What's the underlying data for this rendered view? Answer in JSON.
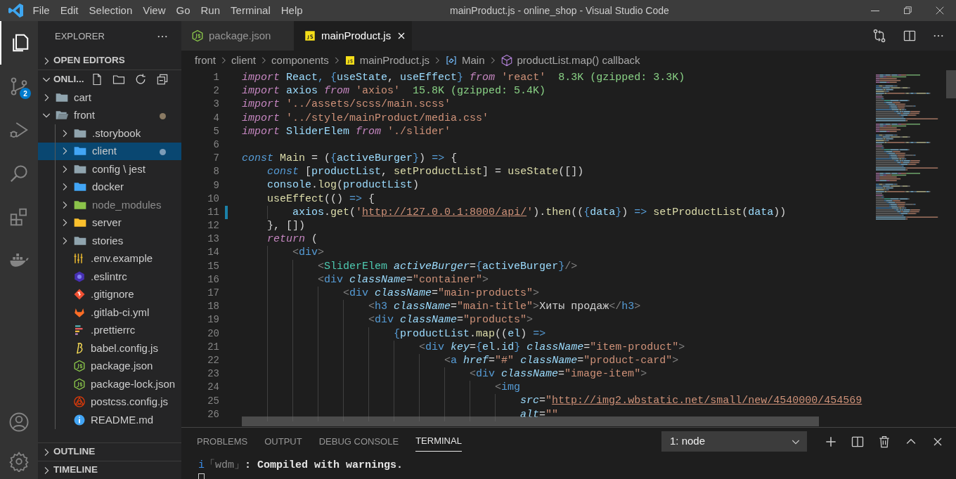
{
  "title_bar": {
    "menus": [
      "File",
      "Edit",
      "Selection",
      "View",
      "Go",
      "Run",
      "Terminal",
      "Help"
    ],
    "title": "mainProduct.js - online_shop - Visual Studio Code"
  },
  "activity_bar": {
    "items": [
      {
        "selected": true
      },
      {
        "selected": false,
        "badge": "2"
      },
      {
        "selected": false
      },
      {
        "selected": false
      },
      {
        "selected": false
      },
      {
        "selected": false
      }
    ]
  },
  "explorer": {
    "header": "EXPLORER",
    "open_editors": {
      "label": "OPEN EDITORS",
      "expanded": false
    },
    "folder": {
      "label": "ONLI...",
      "expanded": true,
      "tree": [
        {
          "label": "cart",
          "kind": "folder",
          "expanded": false,
          "selected": false,
          "modified": false,
          "dimmed": false
        },
        {
          "label": "front",
          "kind": "folder",
          "expanded": true,
          "selected": false,
          "modified": true,
          "dimmed": false,
          "children": [
            {
              "label": ".storybook",
              "kind": "folder",
              "expanded": false,
              "selected": false,
              "modified": false,
              "dimmed": false
            },
            {
              "label": "client",
              "kind": "folder",
              "expanded": false,
              "selected": true,
              "modified": true,
              "dimmed": false
            },
            {
              "label": "config \\ jest",
              "kind": "folder",
              "expanded": false,
              "selected": false,
              "modified": false,
              "dimmed": false
            },
            {
              "label": "docker",
              "kind": "folder",
              "expanded": false,
              "selected": false,
              "modified": false,
              "dimmed": false
            },
            {
              "label": "node_modules",
              "kind": "folder",
              "expanded": false,
              "selected": false,
              "modified": false,
              "dimmed": true
            },
            {
              "label": "server",
              "kind": "folder",
              "expanded": false,
              "selected": false,
              "modified": false,
              "dimmed": false
            },
            {
              "label": "stories",
              "kind": "folder",
              "expanded": false,
              "selected": false,
              "modified": false,
              "dimmed": false
            },
            {
              "label": ".env.example",
              "kind": "file",
              "selected": false,
              "modified": false,
              "dimmed": false
            },
            {
              "label": ".eslintrc",
              "kind": "file",
              "selected": false,
              "modified": false,
              "dimmed": false
            },
            {
              "label": ".gitignore",
              "kind": "file",
              "selected": false,
              "modified": false,
              "dimmed": false
            },
            {
              "label": ".gitlab-ci.yml",
              "kind": "file",
              "selected": false,
              "modified": false,
              "dimmed": false
            },
            {
              "label": ".prettierrc",
              "kind": "file",
              "selected": false,
              "modified": false,
              "dimmed": false
            },
            {
              "label": "babel.config.js",
              "kind": "file",
              "selected": false,
              "modified": false,
              "dimmed": false
            },
            {
              "label": "package.json",
              "kind": "file",
              "selected": false,
              "modified": false,
              "dimmed": false
            },
            {
              "label": "package-lock.json",
              "kind": "file",
              "selected": false,
              "modified": false,
              "dimmed": false
            },
            {
              "label": "postcss.config.js",
              "kind": "file",
              "selected": false,
              "modified": false,
              "dimmed": false
            },
            {
              "label": "README.md",
              "kind": "file",
              "selected": false,
              "modified": false,
              "dimmed": false
            }
          ]
        }
      ]
    },
    "sections": [
      {
        "label": "OUTLINE",
        "expanded": false
      },
      {
        "label": "TIMELINE",
        "expanded": false
      }
    ]
  },
  "tabs": [
    {
      "label": "package.json",
      "selected": false
    },
    {
      "label": "mainProduct.js",
      "selected": true
    }
  ],
  "breadcrumb": [
    "front",
    "client",
    "components",
    "mainProduct.js",
    "Main",
    "productList.map() callback"
  ],
  "code": [
    {
      "n": "1",
      "modified": false,
      "tokens": [
        {
          "text": "import",
          "kind": "kw"
        },
        {
          "text": " React",
          "kind": "v"
        },
        {
          "text": ", {",
          "kind": "br"
        },
        {
          "text": "useState",
          "kind": "v"
        },
        {
          "text": ", ",
          "kind": "p"
        },
        {
          "text": "useEffect",
          "kind": "v"
        },
        {
          "text": "}",
          "kind": "br"
        },
        {
          "text": " from",
          "kind": "kw"
        },
        {
          "text": " 'react'",
          "kind": "s"
        },
        {
          "text": "  8.3K (gzipped: 3.3K)",
          "kind": "h"
        }
      ]
    },
    {
      "n": "2",
      "modified": false,
      "tokens": [
        {
          "text": "import",
          "kind": "kw"
        },
        {
          "text": " axios",
          "kind": "v"
        },
        {
          "text": " from",
          "kind": "kw"
        },
        {
          "text": " 'axios'",
          "kind": "s"
        },
        {
          "text": "  15.8K (gzipped: 5.4K)",
          "kind": "h"
        }
      ]
    },
    {
      "n": "3",
      "modified": false,
      "tokens": [
        {
          "text": "import",
          "kind": "kw"
        },
        {
          "text": " '../assets/scss/main.scss'",
          "kind": "s"
        }
      ]
    },
    {
      "n": "4",
      "modified": false,
      "tokens": [
        {
          "text": "import",
          "kind": "kw"
        },
        {
          "text": " '../style/mainProduct/media.css'",
          "kind": "s"
        }
      ]
    },
    {
      "n": "5",
      "modified": false,
      "tokens": [
        {
          "text": "import",
          "kind": "kw"
        },
        {
          "text": " SliderElem",
          "kind": "v"
        },
        {
          "text": " from",
          "kind": "kw"
        },
        {
          "text": " './slider'",
          "kind": "s"
        }
      ]
    },
    {
      "n": "6",
      "modified": false
    },
    {
      "n": "7",
      "modified": false,
      "tokens": [
        {
          "text": "const",
          "kind": "st"
        },
        {
          "text": " Main",
          "kind": "f"
        },
        {
          "text": " = (",
          "kind": "p"
        },
        {
          "text": "{",
          "kind": "br"
        },
        {
          "text": "activeBurger",
          "kind": "v"
        },
        {
          "text": "}",
          "kind": "br"
        },
        {
          "text": ") ",
          "kind": "p"
        },
        {
          "text": "=>",
          "kind": "st"
        },
        {
          "text": " {",
          "kind": "p"
        }
      ]
    },
    {
      "n": "8",
      "modified": false,
      "tokens": [
        {
          "text": "    const",
          "kind": "st"
        },
        {
          "text": " [",
          "kind": "p"
        },
        {
          "text": "productList",
          "kind": "v"
        },
        {
          "text": ", ",
          "kind": "p"
        },
        {
          "text": "setProductList",
          "kind": "f"
        },
        {
          "text": "] = ",
          "kind": "p"
        },
        {
          "text": "useState",
          "kind": "f"
        },
        {
          "text": "([])",
          "kind": "p"
        }
      ]
    },
    {
      "n": "9",
      "modified": false,
      "tokens": [
        {
          "text": "    console",
          "kind": "v"
        },
        {
          "text": ".",
          "kind": "p"
        },
        {
          "text": "log",
          "kind": "f"
        },
        {
          "text": "(",
          "kind": "p"
        },
        {
          "text": "productList",
          "kind": "v"
        },
        {
          "text": ")",
          "kind": "p"
        }
      ]
    },
    {
      "n": "10",
      "modified": false,
      "tokens": [
        {
          "text": "    useEffect",
          "kind": "f"
        },
        {
          "text": "(() ",
          "kind": "p"
        },
        {
          "text": "=>",
          "kind": "st"
        },
        {
          "text": " {",
          "kind": "p"
        }
      ]
    },
    {
      "n": "11",
      "modified": true,
      "tokens": [
        {
          "text": "        axios",
          "kind": "v"
        },
        {
          "text": ".",
          "kind": "p"
        },
        {
          "text": "get",
          "kind": "f"
        },
        {
          "text": "(",
          "kind": "p"
        },
        {
          "text": "'",
          "kind": "s"
        },
        {
          "text": "http://127.0.0.1:8000/api/",
          "kind": "u"
        },
        {
          "text": "'",
          "kind": "s"
        },
        {
          "text": ").",
          "kind": "p"
        },
        {
          "text": "then",
          "kind": "f"
        },
        {
          "text": "((",
          "kind": "p"
        },
        {
          "text": "{",
          "kind": "br"
        },
        {
          "text": "data",
          "kind": "v"
        },
        {
          "text": "}",
          "kind": "br"
        },
        {
          "text": ") ",
          "kind": "p"
        },
        {
          "text": "=>",
          "kind": "st"
        },
        {
          "text": " setProductList",
          "kind": "f"
        },
        {
          "text": "(",
          "kind": "p"
        },
        {
          "text": "data",
          "kind": "v"
        },
        {
          "text": "))",
          "kind": "p"
        }
      ]
    },
    {
      "n": "12",
      "modified": false,
      "tokens": [
        {
          "text": "    }, [])",
          "kind": "p"
        }
      ]
    },
    {
      "n": "13",
      "modified": false,
      "tokens": [
        {
          "text": "    return",
          "kind": "kw"
        },
        {
          "text": " (",
          "kind": "p"
        }
      ]
    },
    {
      "n": "14",
      "modified": false,
      "tokens": [
        {
          "text": "        <",
          "kind": "tg"
        },
        {
          "text": "div",
          "kind": "tn"
        },
        {
          "text": ">",
          "kind": "tg"
        }
      ]
    },
    {
      "n": "15",
      "modified": false,
      "tokens": [
        {
          "text": "            <",
          "kind": "tg"
        },
        {
          "text": "SliderElem",
          "kind": "cmp"
        },
        {
          "text": " activeBurger",
          "kind": "at"
        },
        {
          "text": "=",
          "kind": "p"
        },
        {
          "text": "{",
          "kind": "br"
        },
        {
          "text": "activeBurger",
          "kind": "v"
        },
        {
          "text": "}",
          "kind": "br"
        },
        {
          "text": "/>",
          "kind": "tg"
        }
      ]
    },
    {
      "n": "16",
      "modified": false,
      "tokens": [
        {
          "text": "            <",
          "kind": "tg"
        },
        {
          "text": "div",
          "kind": "tn"
        },
        {
          "text": " className",
          "kind": "at"
        },
        {
          "text": "=",
          "kind": "p"
        },
        {
          "text": "\"container\"",
          "kind": "s"
        },
        {
          "text": ">",
          "kind": "tg"
        }
      ]
    },
    {
      "n": "17",
      "modified": false,
      "tokens": [
        {
          "text": "                <",
          "kind": "tg"
        },
        {
          "text": "div",
          "kind": "tn"
        },
        {
          "text": " className",
          "kind": "at"
        },
        {
          "text": "=",
          "kind": "p"
        },
        {
          "text": "\"main-products\"",
          "kind": "s"
        },
        {
          "text": ">",
          "kind": "tg"
        }
      ]
    },
    {
      "n": "18",
      "modified": false,
      "tokens": [
        {
          "text": "                    <",
          "kind": "tg"
        },
        {
          "text": "h3",
          "kind": "tn"
        },
        {
          "text": " className",
          "kind": "at"
        },
        {
          "text": "=",
          "kind": "p"
        },
        {
          "text": "\"main-title\"",
          "kind": "s"
        },
        {
          "text": ">",
          "kind": "tg"
        },
        {
          "text": "Хиты продаж",
          "kind": "p"
        },
        {
          "text": "</",
          "kind": "tg"
        },
        {
          "text": "h3",
          "kind": "tn"
        },
        {
          "text": ">",
          "kind": "tg"
        }
      ]
    },
    {
      "n": "19",
      "modified": false,
      "tokens": [
        {
          "text": "                    <",
          "kind": "tg"
        },
        {
          "text": "div",
          "kind": "tn"
        },
        {
          "text": " className",
          "kind": "at"
        },
        {
          "text": "=",
          "kind": "p"
        },
        {
          "text": "\"products\"",
          "kind": "s"
        },
        {
          "text": ">",
          "kind": "tg"
        }
      ]
    },
    {
      "n": "20",
      "modified": false,
      "tokens": [
        {
          "text": "                        {",
          "kind": "br"
        },
        {
          "text": "productList",
          "kind": "v"
        },
        {
          "text": ".",
          "kind": "p"
        },
        {
          "text": "map",
          "kind": "f"
        },
        {
          "text": "((",
          "kind": "p"
        },
        {
          "text": "el",
          "kind": "v"
        },
        {
          "text": ") ",
          "kind": "p"
        },
        {
          "text": "=>",
          "kind": "st"
        }
      ]
    },
    {
      "n": "21",
      "modified": false,
      "tokens": [
        {
          "text": "                            <",
          "kind": "tg"
        },
        {
          "text": "div",
          "kind": "tn"
        },
        {
          "text": " key",
          "kind": "at"
        },
        {
          "text": "=",
          "kind": "p"
        },
        {
          "text": "{",
          "kind": "br"
        },
        {
          "text": "el",
          "kind": "v"
        },
        {
          "text": ".",
          "kind": "p"
        },
        {
          "text": "id",
          "kind": "v"
        },
        {
          "text": "}",
          "kind": "br"
        },
        {
          "text": " className",
          "kind": "at"
        },
        {
          "text": "=",
          "kind": "p"
        },
        {
          "text": "\"item-product\"",
          "kind": "s"
        },
        {
          "text": ">",
          "kind": "tg"
        }
      ]
    },
    {
      "n": "22",
      "modified": false,
      "tokens": [
        {
          "text": "                                <",
          "kind": "tg"
        },
        {
          "text": "a",
          "kind": "tn"
        },
        {
          "text": " href",
          "kind": "at"
        },
        {
          "text": "=",
          "kind": "p"
        },
        {
          "text": "\"#\"",
          "kind": "s"
        },
        {
          "text": " className",
          "kind": "at"
        },
        {
          "text": "=",
          "kind": "p"
        },
        {
          "text": "\"product-card\"",
          "kind": "s"
        },
        {
          "text": ">",
          "kind": "tg"
        }
      ]
    },
    {
      "n": "23",
      "modified": false,
      "tokens": [
        {
          "text": "                                    <",
          "kind": "tg"
        },
        {
          "text": "div",
          "kind": "tn"
        },
        {
          "text": " className",
          "kind": "at"
        },
        {
          "text": "=",
          "kind": "p"
        },
        {
          "text": "\"image-item\"",
          "kind": "s"
        },
        {
          "text": ">",
          "kind": "tg"
        }
      ]
    },
    {
      "n": "24",
      "modified": false,
      "tokens": [
        {
          "text": "                                        <",
          "kind": "tg"
        },
        {
          "text": "img",
          "kind": "tn"
        }
      ]
    },
    {
      "n": "25",
      "modified": false,
      "tokens": [
        {
          "text": "                                            src",
          "kind": "at"
        },
        {
          "text": "=",
          "kind": "p"
        },
        {
          "text": "\"",
          "kind": "s"
        },
        {
          "text": "http://img2.wbstatic.net/small/new/4540000/454569",
          "kind": "u"
        }
      ]
    },
    {
      "n": "26",
      "modified": false,
      "tokens": [
        {
          "text": "                                            alt",
          "kind": "at"
        },
        {
          "text": "=",
          "kind": "p"
        },
        {
          "text": "\"\"",
          "kind": "s"
        }
      ]
    }
  ],
  "panel": {
    "tabs": [
      {
        "label": "PROBLEMS",
        "selected": false
      },
      {
        "label": "OUTPUT",
        "selected": false
      },
      {
        "label": "DEBUG CONSOLE",
        "selected": false
      },
      {
        "label": "TERMINAL",
        "selected": true
      }
    ],
    "terminal_select": "1: node",
    "terminal": {
      "prefix": "i",
      "source": "「wdm」",
      "message": ": Compiled with warnings."
    }
  }
}
